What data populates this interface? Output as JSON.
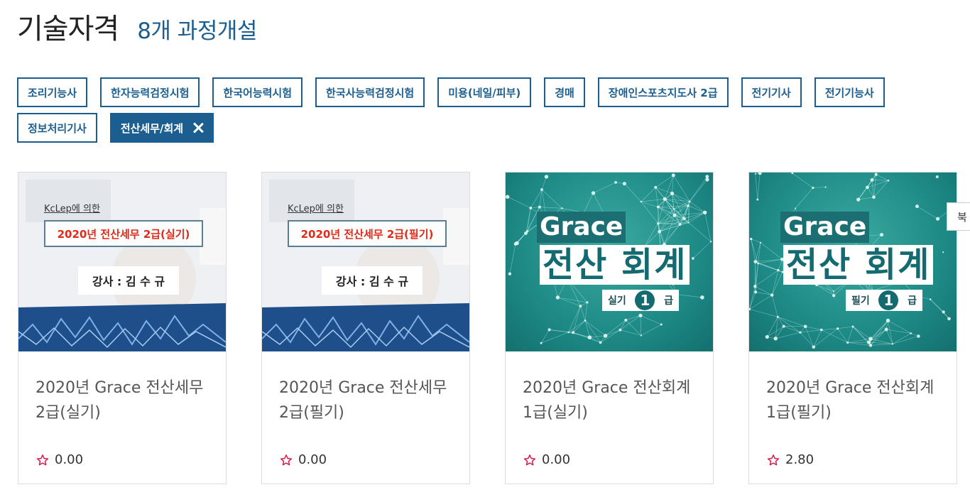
{
  "header": {
    "title": "기술자격",
    "subtitle": "8개 과정개설"
  },
  "tags": [
    {
      "label": "조리기능사",
      "active": false
    },
    {
      "label": "한자능력검정시험",
      "active": false
    },
    {
      "label": "한국어능력시험",
      "active": false
    },
    {
      "label": "한국사능력검정시험",
      "active": false
    },
    {
      "label": "미용(네일/피부)",
      "active": false
    },
    {
      "label": "경매",
      "active": false
    },
    {
      "label": "장애인스포츠지도사 2급",
      "active": false
    },
    {
      "label": "전기기사",
      "active": false
    },
    {
      "label": "전기기능사",
      "active": false
    },
    {
      "label": "정보처리기사",
      "active": false
    },
    {
      "label": "전산세무/회계",
      "active": true
    }
  ],
  "cards": [
    {
      "thumb_type": "tax",
      "thumb_source": "KcLep에 의한",
      "thumb_course": "2020년 전산세무 2급(실기)",
      "thumb_teacher": "강사 : 김 수 규",
      "title_line1": "2020년 Grace 전산세무",
      "title_line2": "2급(실기)",
      "rating": "0.00"
    },
    {
      "thumb_type": "tax",
      "thumb_source": "KcLep에 의한",
      "thumb_course": "2020년 전산세무 2급(필기)",
      "thumb_teacher": "강사 : 김 수 규",
      "title_line1": "2020년 Grace 전산세무",
      "title_line2": "2급(필기)",
      "rating": "0.00"
    },
    {
      "thumb_type": "grace",
      "thumb_brand": "Grace",
      "thumb_main": "전산 회계",
      "thumb_level_pre": "실기",
      "thumb_level_num": "1",
      "thumb_level_post": "급",
      "title_line1": "2020년 Grace 전산회계",
      "title_line2": "1급(실기)",
      "rating": "0.00"
    },
    {
      "thumb_type": "grace",
      "thumb_brand": "Grace",
      "thumb_main": "전산 회계",
      "thumb_level_pre": "필기",
      "thumb_level_num": "1",
      "thumb_level_post": "급",
      "title_line1": "2020년 Grace 전산회계",
      "title_line2": "1급(필기)",
      "rating": "2.80"
    }
  ],
  "side_tab": {
    "label": "북"
  },
  "icons": {
    "tag_close": "close-icon",
    "rating": "star-outline-icon"
  },
  "colors": {
    "accent": "#1c5e8f",
    "star": "#d81b4b",
    "tax_course_text": "#e02a1a",
    "grace_bg": "#1e8a86"
  }
}
